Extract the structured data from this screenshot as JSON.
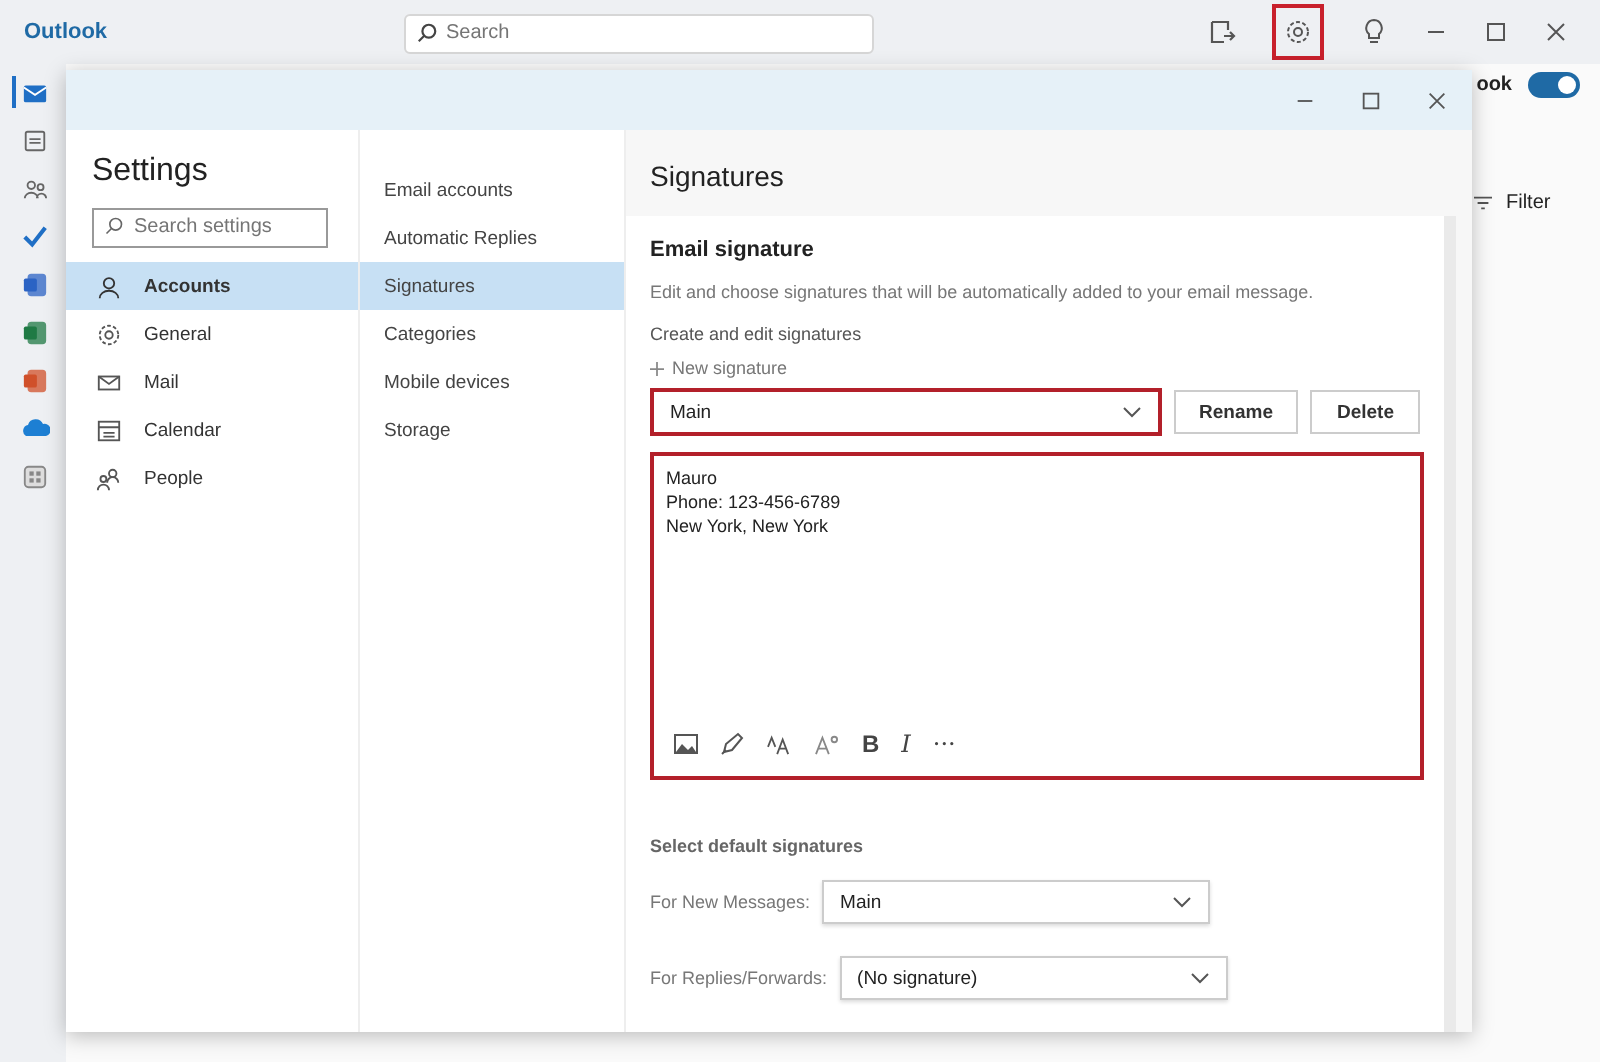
{
  "app": {
    "title": "Outlook",
    "search_placeholder": "Search",
    "gear_highlighted": true
  },
  "background": {
    "label_cut": "ook",
    "toggle_on": true,
    "filter": "Filter"
  },
  "rail": [
    {
      "kind": "mail",
      "selected": true
    },
    {
      "kind": "calendar",
      "selected": false
    },
    {
      "kind": "people",
      "selected": false
    },
    {
      "kind": "todo",
      "selected": false
    },
    {
      "kind": "word",
      "selected": false
    },
    {
      "kind": "excel",
      "selected": false
    },
    {
      "kind": "powerpoint",
      "selected": false
    },
    {
      "kind": "cloud",
      "selected": false
    },
    {
      "kind": "apps",
      "selected": false
    }
  ],
  "settings": {
    "title": "Settings",
    "search_placeholder": "Search settings",
    "categories": [
      {
        "label": "Accounts",
        "kind": "person",
        "selected": true
      },
      {
        "label": "General",
        "kind": "gear",
        "selected": false
      },
      {
        "label": "Mail",
        "kind": "mail",
        "selected": false
      },
      {
        "label": "Calendar",
        "kind": "calendar",
        "selected": false
      },
      {
        "label": "People",
        "kind": "people",
        "selected": false
      }
    ],
    "subcategories": [
      {
        "label": "Email accounts",
        "selected": false
      },
      {
        "label": "Automatic Replies",
        "selected": false
      },
      {
        "label": "Signatures",
        "selected": true
      },
      {
        "label": "Categories",
        "selected": false
      },
      {
        "label": "Mobile devices",
        "selected": false
      },
      {
        "label": "Storage",
        "selected": false
      }
    ]
  },
  "content": {
    "title": "Signatures",
    "section": "Email signature",
    "description": "Edit and choose signatures that will be automatically added to your email message.",
    "create_label": "Create and edit signatures",
    "new_signature": "New signature",
    "signature_select": {
      "value": "Main",
      "highlighted": true
    },
    "buttons": [
      "Rename",
      "Delete"
    ],
    "editor": {
      "lines": [
        "Mauro",
        "Phone: 123-456-6789",
        "New York, New York"
      ],
      "highlighted": true
    },
    "toolbar": [
      {
        "kind": "image"
      },
      {
        "kind": "brush"
      },
      {
        "kind": "fontsize"
      },
      {
        "kind": "superscript"
      },
      {
        "kind": "bold",
        "label": "B"
      },
      {
        "kind": "italic",
        "label": "I"
      },
      {
        "kind": "more",
        "label": "···"
      }
    ],
    "defaults_title": "Select default signatures",
    "defaults": [
      {
        "label": "For New Messages:",
        "value": "Main"
      },
      {
        "label": "For Replies/Forwards:",
        "value": "(No signature)"
      }
    ]
  }
}
